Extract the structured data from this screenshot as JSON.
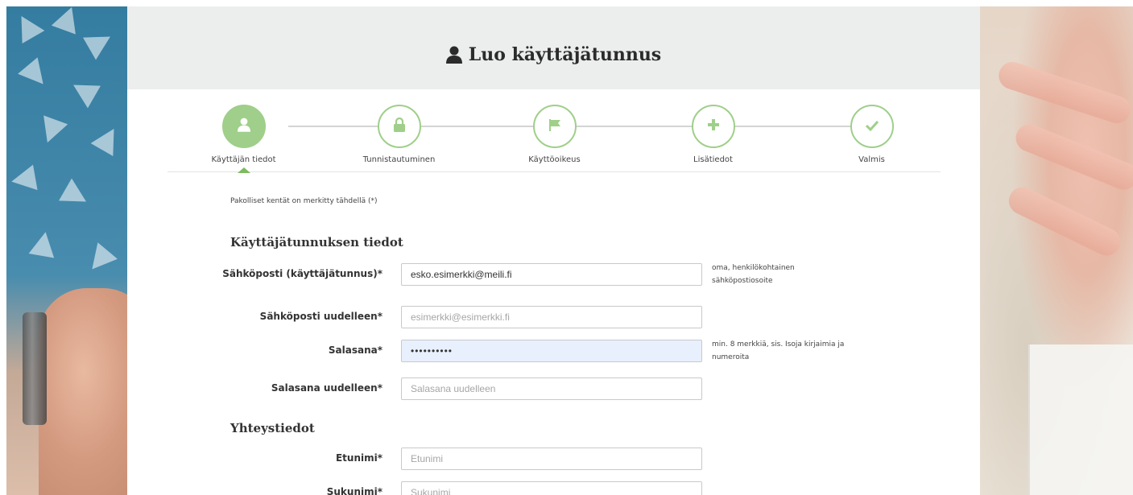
{
  "header": {
    "title": "Luo käyttäjätunnus",
    "title_icon": "user-icon"
  },
  "stepper": {
    "steps": [
      {
        "label": "Käyttäjän tiedot",
        "icon": "user-icon",
        "active": true
      },
      {
        "label": "Tunnistautuminen",
        "icon": "lock-icon",
        "active": false
      },
      {
        "label": "Käyttöoikeus",
        "icon": "flag-icon",
        "active": false
      },
      {
        "label": "Lisätiedot",
        "icon": "plus-icon",
        "active": false
      },
      {
        "label": "Valmis",
        "icon": "check-icon",
        "active": false
      }
    ]
  },
  "form": {
    "required_note": "Pakolliset kentät on merkitty tähdellä (*)",
    "account_section": {
      "title": "Käyttäjätunnuksen tiedot",
      "email": {
        "label": "Sähköposti (käyttäjätunnus)*",
        "value": "esko.esimerkki@meili.fi",
        "placeholder": "",
        "hint": "oma, henkilökohtainen sähköpostiosoite"
      },
      "email_repeat": {
        "label": "Sähköposti uudelleen*",
        "value": "",
        "placeholder": "esimerkki@esimerkki.fi"
      },
      "password": {
        "label": "Salasana*",
        "value": "••••••••••",
        "placeholder": "",
        "hint": "min. 8 merkkiä, sis. Isoja kirjaimia ja numeroita"
      },
      "password_repeat": {
        "label": "Salasana uudelleen*",
        "value": "",
        "placeholder": "Salasana uudelleen"
      }
    },
    "contact_section": {
      "title": "Yhteystiedot",
      "first_name": {
        "label": "Etunimi*",
        "value": "",
        "placeholder": "Etunimi"
      },
      "last_name": {
        "label": "Sukunimi*",
        "value": "",
        "placeholder": "Sukunimi"
      }
    }
  },
  "colors": {
    "accent_green": "#9fcf8a",
    "caret_green": "#7dbb5f",
    "header_bg": "#eceeee",
    "autofill_blue": "#e8f0fe"
  }
}
